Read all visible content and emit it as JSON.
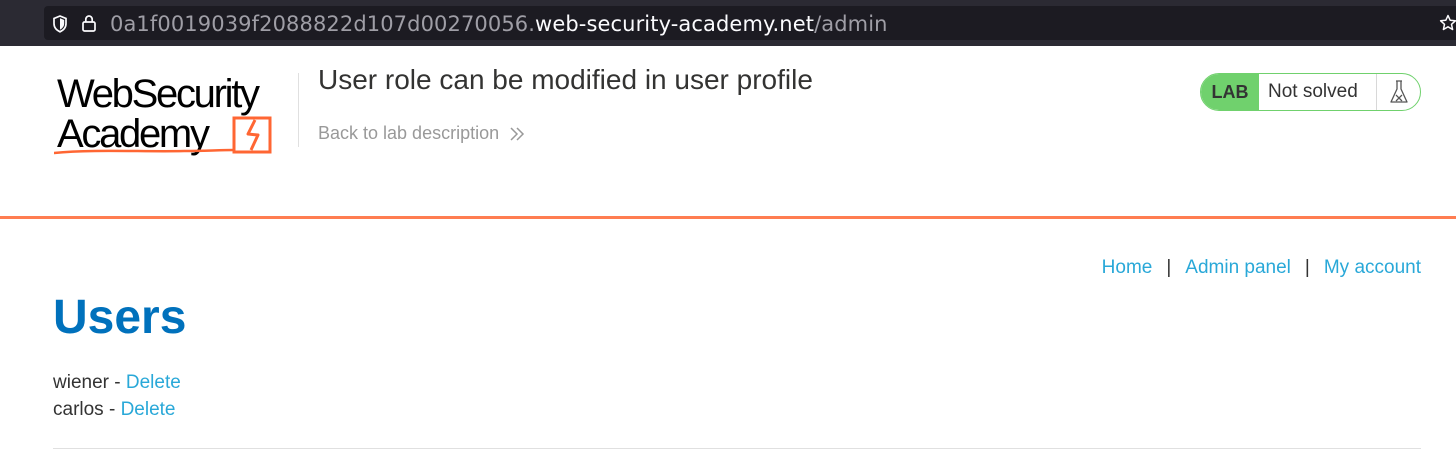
{
  "browser": {
    "url_subdomain": "0a1f0019039f2088822d107d00270056.",
    "url_domain": "web-security-academy.net",
    "url_path": "/admin"
  },
  "header": {
    "logo_line1": "WebSecurity",
    "logo_line2": "Academy",
    "lab_title": "User role can be modified in user profile",
    "back_link": "Back to lab description",
    "lab_badge": "LAB",
    "lab_state": "Not solved"
  },
  "nav": {
    "items": [
      {
        "label": "Home"
      },
      {
        "label": "Admin panel"
      },
      {
        "label": "My account"
      }
    ],
    "separator": "|"
  },
  "main": {
    "title": "Users",
    "users": [
      {
        "name": "wiener",
        "dash": " - ",
        "action": "Delete"
      },
      {
        "name": "carlos",
        "dash": " - ",
        "action": "Delete"
      }
    ]
  },
  "colors": {
    "accent": "#ff6633",
    "link": "#29a8d8",
    "title": "#0071bc",
    "lab_green": "#70d16d"
  }
}
